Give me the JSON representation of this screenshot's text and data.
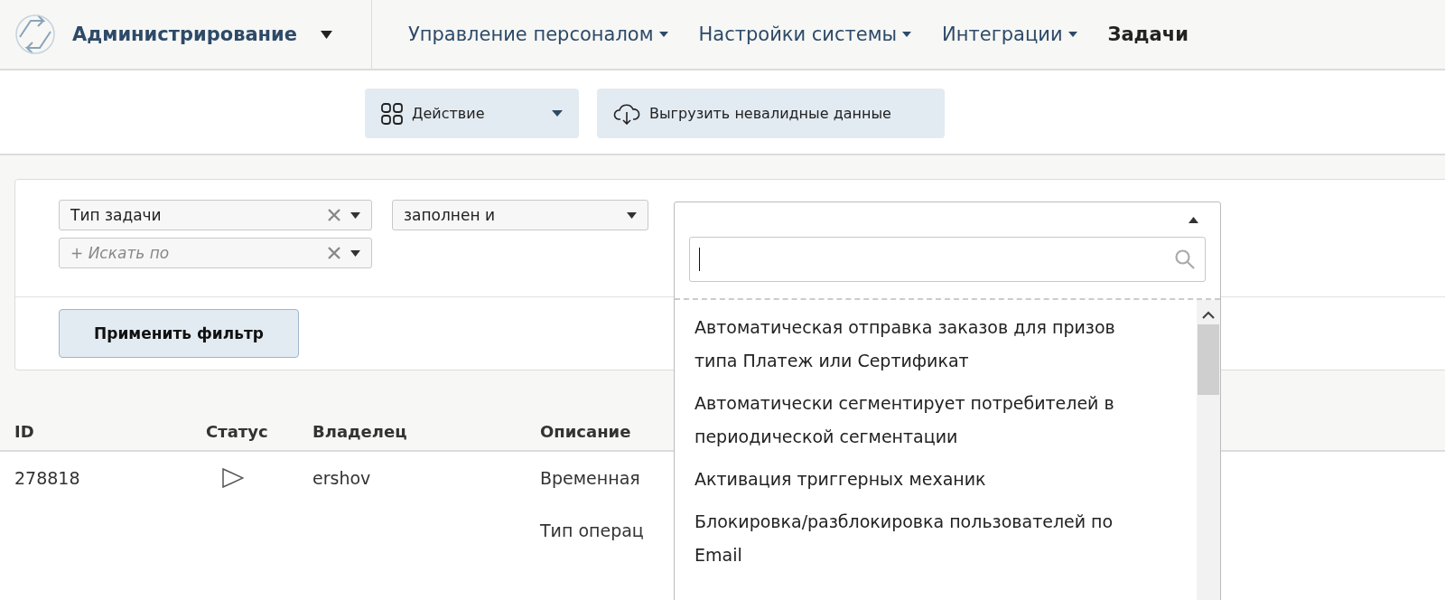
{
  "nav": {
    "brand": "Администрирование",
    "menus": [
      {
        "label": "Управление персоналом",
        "has_menu": true,
        "selected": false
      },
      {
        "label": "Настройки системы",
        "has_menu": true,
        "selected": false
      },
      {
        "label": "Интеграции",
        "has_menu": true,
        "selected": false
      },
      {
        "label": "Задачи",
        "has_menu": false,
        "selected": true
      }
    ]
  },
  "toolbar": {
    "buttons": [
      {
        "label": "Действие",
        "kind": "menu"
      },
      {
        "label": "Выгрузить невалидные данные",
        "kind": "export"
      }
    ]
  },
  "filter": {
    "rows": [
      {
        "field": {
          "value": "Тип задачи"
        },
        "operator": {
          "value": "заполнен и"
        }
      },
      {
        "field": {
          "placeholder": "+ Искать по"
        }
      }
    ],
    "apply_button": "Применить фильтр",
    "dropdown": {
      "expanded": true,
      "options": [
        "Автоматическая отправка заказов для призов типа Платеж или Сертификат",
        "Автоматически сегментирует потребителей в периодической сегментации",
        "Активация триггерных механик",
        "Блокировка/разблокировка пользователей по Email"
      ]
    }
  },
  "table": {
    "columns": [
      "ID",
      "Статус",
      "Владелец",
      "Описание"
    ],
    "rows": [
      {
        "id": "278818",
        "owner": "ershov",
        "description": [
          "Временная",
          "Тип операц"
        ]
      }
    ]
  }
}
